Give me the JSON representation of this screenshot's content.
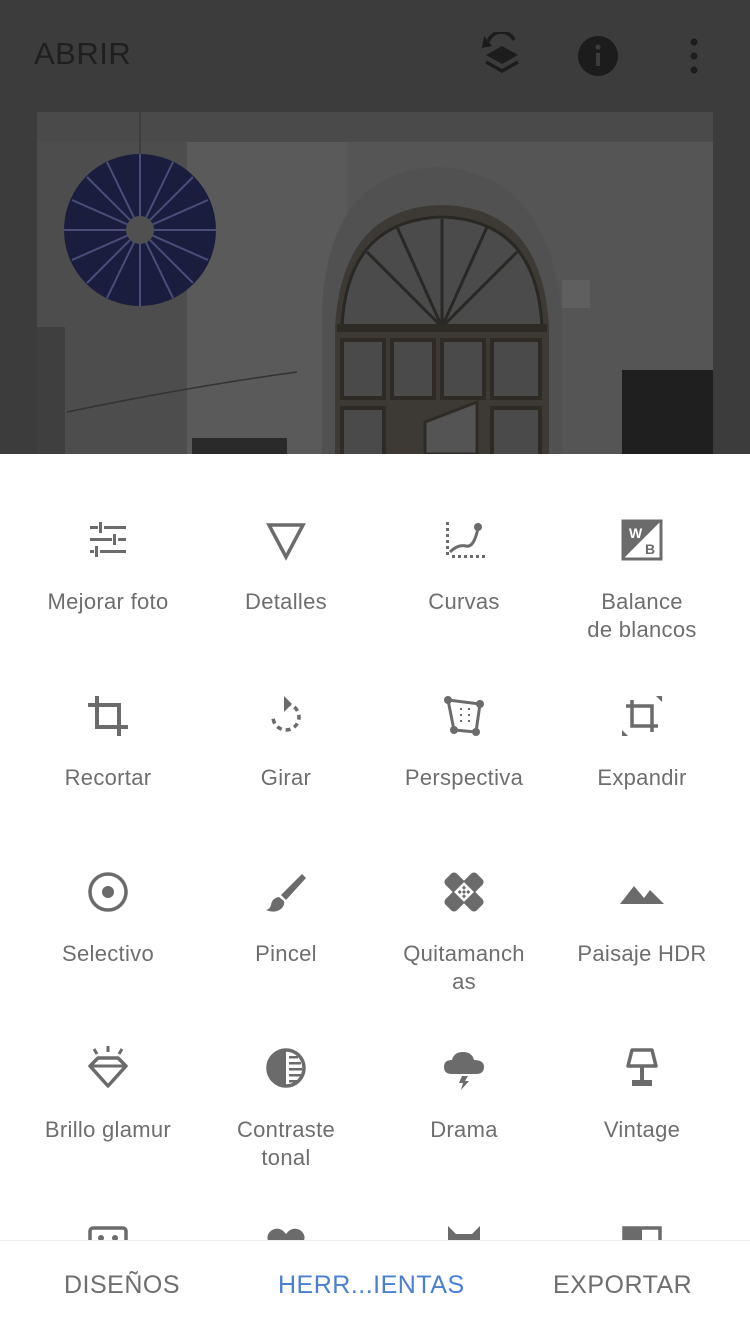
{
  "header": {
    "open_label": "ABRIR"
  },
  "tools": [
    {
      "label": "Mejorar foto",
      "icon": "tune-sliders-icon"
    },
    {
      "label": "Detalles",
      "icon": "triangle-details-icon"
    },
    {
      "label": "Curvas",
      "icon": "curves-icon"
    },
    {
      "label": "Balance\nde blancos",
      "icon": "white-balance-icon"
    },
    {
      "label": "Recortar",
      "icon": "crop-icon"
    },
    {
      "label": "Girar",
      "icon": "rotate-icon"
    },
    {
      "label": "Perspectiva",
      "icon": "perspective-icon"
    },
    {
      "label": "Expandir",
      "icon": "expand-icon"
    },
    {
      "label": "Selectivo",
      "icon": "selective-target-icon"
    },
    {
      "label": "Pincel",
      "icon": "brush-icon"
    },
    {
      "label": "Quitamanch\nas",
      "icon": "healing-bandage-icon"
    },
    {
      "label": "Paisaje HDR",
      "icon": "mountains-icon"
    },
    {
      "label": "Brillo glamur",
      "icon": "diamond-glow-icon"
    },
    {
      "label": "Contraste\ntonal",
      "icon": "tonal-contrast-icon"
    },
    {
      "label": "Drama",
      "icon": "storm-cloud-icon"
    },
    {
      "label": "Vintage",
      "icon": "lamp-icon"
    }
  ],
  "tabs": {
    "designs": "DISEÑOS",
    "tools": "HERR...IENTAS",
    "export": "EXPORTAR"
  },
  "colors": {
    "accent": "#4a7fd1",
    "icon": "#6b6b6b",
    "overlay": "#3c3c3c"
  }
}
